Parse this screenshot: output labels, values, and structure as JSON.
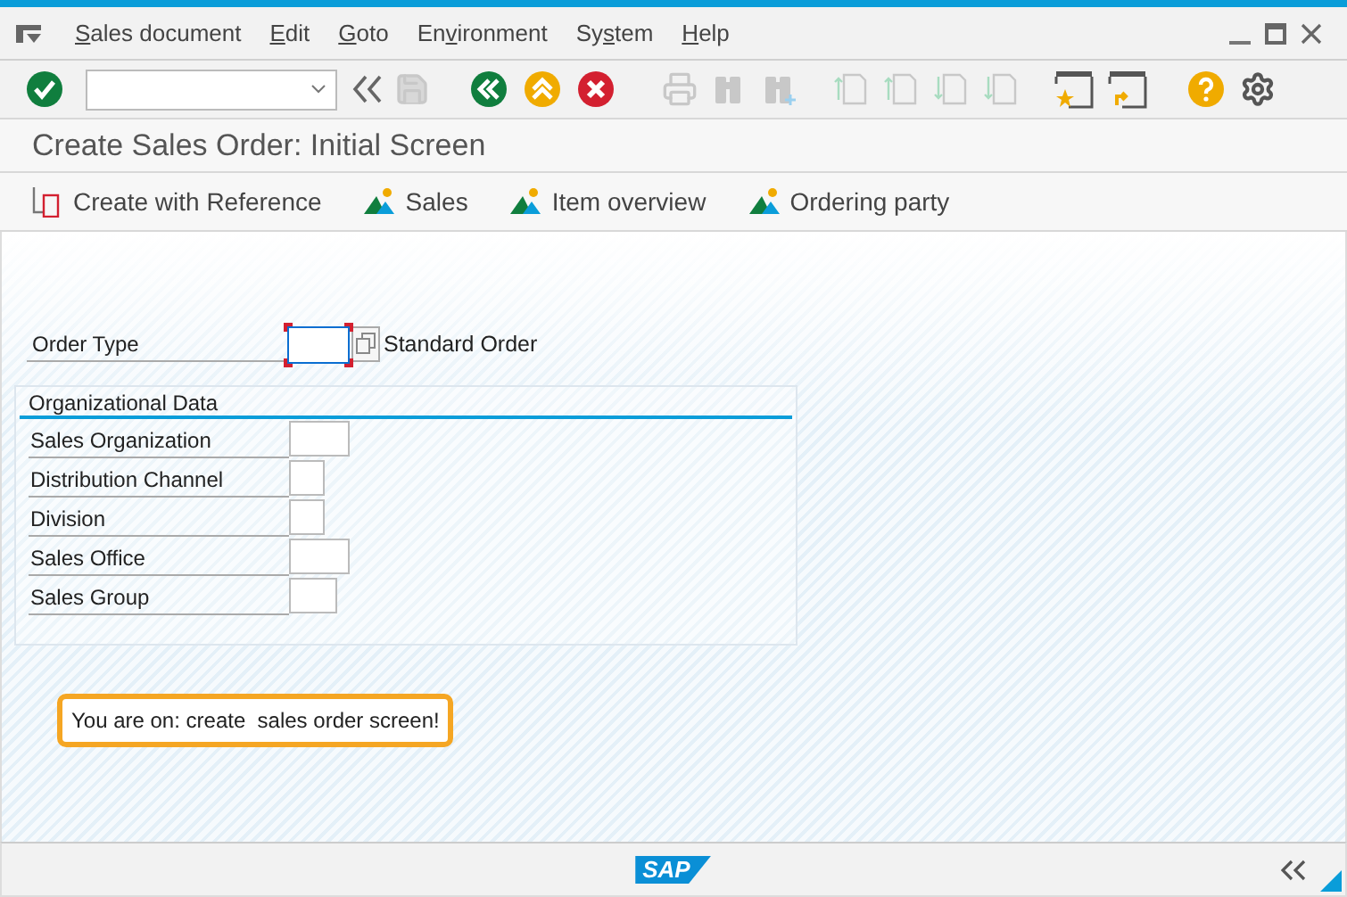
{
  "menu": [
    {
      "key": "S",
      "post": "ales document"
    },
    {
      "key": "E",
      "post": "dit"
    },
    {
      "key": "G",
      "post": "oto"
    },
    {
      "pre": "En",
      "key": "v",
      "post": "ironment"
    },
    {
      "pre": "Sy",
      "key": "s",
      "post": "tem"
    },
    {
      "key": "H",
      "post": "elp"
    }
  ],
  "toolbar_buttons": [
    {
      "disabled": true
    },
    {
      "disabled": false
    },
    {
      "disabled": false
    },
    {
      "disabled": false
    },
    {
      "disabled": true
    },
    {
      "disabled": true
    },
    {
      "disabled": true
    },
    {
      "disabled": true
    },
    {
      "disabled": true
    },
    {
      "disabled": true
    },
    {
      "disabled": true
    },
    {
      "disabled": false
    },
    {
      "disabled": false
    },
    {
      "disabled": false
    },
    {
      "disabled": false
    }
  ],
  "title": "Create Sales Order: Initial Screen",
  "app_toolbar": [
    {
      "kind": "reference",
      "label": "Create with Reference"
    },
    {
      "kind": "party",
      "label": "Sales"
    },
    {
      "kind": "party",
      "label": "Item overview"
    },
    {
      "kind": "party",
      "label": "Ordering party"
    }
  ],
  "order_type": {
    "label": "Order Type",
    "focused": true,
    "description": "Standard Order"
  },
  "org_data": {
    "title": "Organizational Data",
    "fields": [
      {
        "label": "Sales Organization"
      },
      {
        "label": "Distribution Channel"
      },
      {
        "label": "Division"
      },
      {
        "label": "Sales Office"
      },
      {
        "label": "Sales Group"
      }
    ]
  },
  "message": "You are on: create  sales order screen!",
  "footer": {
    "logo": "SAP"
  }
}
